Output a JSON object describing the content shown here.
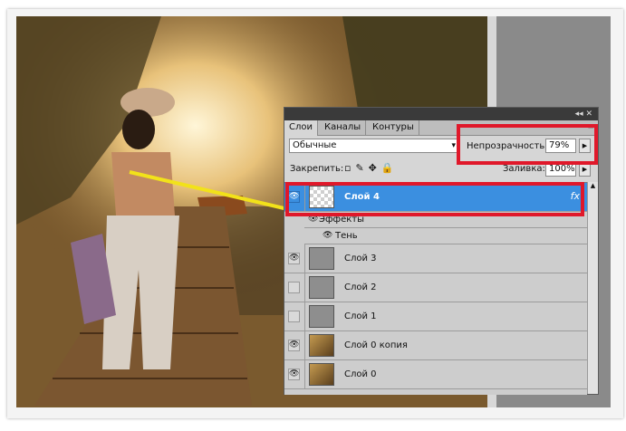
{
  "panel": {
    "tabs": [
      "Слои",
      "Каналы",
      "Контуры"
    ],
    "titlebar_controls": "◂◂ ✕",
    "menu_icon": "≡",
    "blend_mode": "Обычные",
    "opacity_label": "Непрозрачность:",
    "opacity_value": "79%",
    "lock_label": "Закрепить:",
    "lock_icons": "▫✎✥🔒",
    "fill_label": "Заливка:",
    "fill_value": "100%",
    "layers": [
      {
        "name": "Слой 4",
        "visible": true,
        "selected": true,
        "fx": "fx"
      },
      {
        "name": "Слой 3",
        "visible": true
      },
      {
        "name": "Слой 2",
        "visible": false
      },
      {
        "name": "Слой 1",
        "visible": false
      },
      {
        "name": "Слой 0 копия",
        "visible": true
      },
      {
        "name": "Слой 0",
        "visible": true
      }
    ],
    "effects_label": "Эффекты",
    "shadow_label": "Тень"
  },
  "colors": {
    "highlight_red": "#e0182a",
    "selection_blue": "#3b8fe0",
    "arrow_yellow": "#f2e21a"
  }
}
